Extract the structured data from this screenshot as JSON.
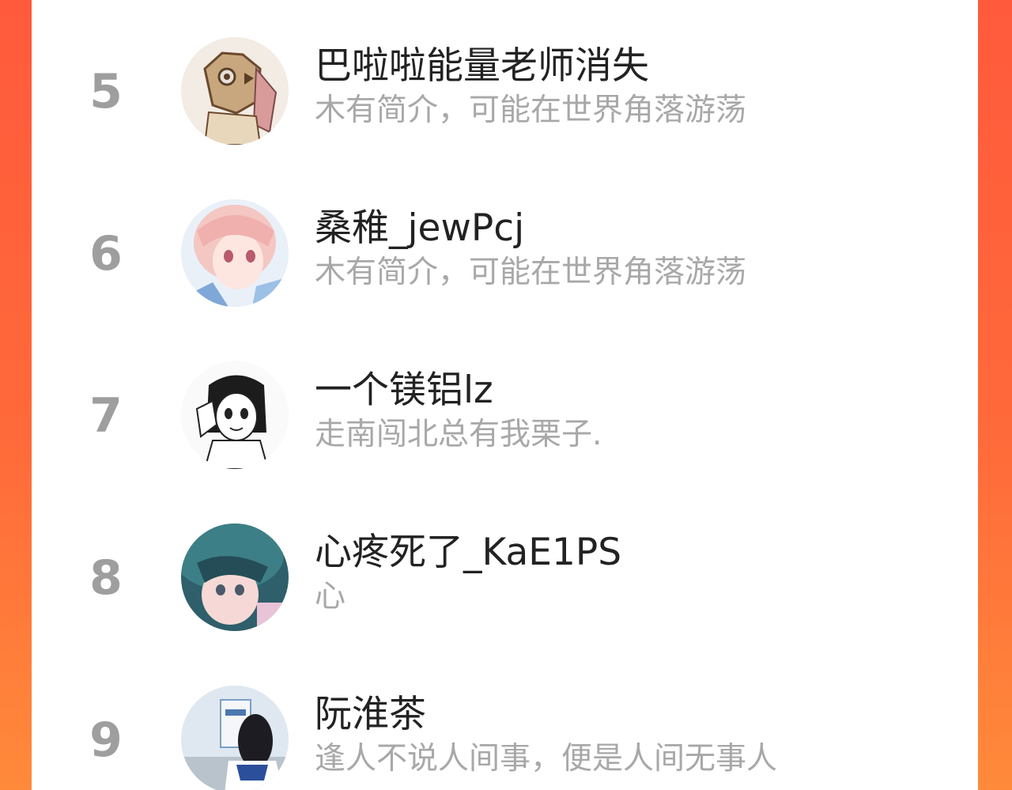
{
  "ranking": {
    "items": [
      {
        "rank": "5",
        "name": "巴啦啦能量老师消失",
        "bio": "木有简介，可能在世界角落游荡",
        "avatar": "avatar-hashibira-mask-icon"
      },
      {
        "rank": "6",
        "name": "桑稚_jewPcj",
        "bio": "木有简介，可能在世界角落游荡",
        "avatar": "avatar-pink-hair-girl-icon"
      },
      {
        "rank": "7",
        "name": "一个镁铝lz",
        "bio": "走南闯北总有我栗子.",
        "avatar": "avatar-manga-girl-icon"
      },
      {
        "rank": "8",
        "name": "心疼死了_KaE1PS",
        "bio": "心",
        "avatar": "avatar-teal-hair-girl-icon"
      },
      {
        "rank": "9",
        "name": "阮淮茶",
        "bio": "逢人不说人间事，便是人间无事人",
        "avatar": "avatar-photo-girl-icon"
      }
    ]
  },
  "colors": {
    "frame_left": "#ff5a3c",
    "frame_right": "#ff8a3a",
    "rank_text": "#9e9e9e",
    "name_text": "#222222",
    "bio_text": "#a8a8a8"
  }
}
